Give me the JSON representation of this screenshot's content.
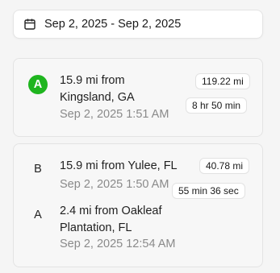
{
  "date_range": {
    "icon": "calendar-icon",
    "label": "Sep 2, 2025 - Sep 2, 2025"
  },
  "trips": [
    {
      "stops": [
        {
          "marker": "A",
          "active": true,
          "title": "15.9 mi from Kingsland, GA",
          "time": "Sep 2, 2025 1:51 AM"
        }
      ],
      "distance": "119.22 mi",
      "duration": "8 hr 50 min"
    },
    {
      "stops": [
        {
          "marker": "B",
          "active": false,
          "title": "15.9 mi from Yulee, FL",
          "time": "Sep 2, 2025 1:50 AM"
        },
        {
          "marker": "A",
          "active": false,
          "title": "2.4 mi from Oakleaf Plantation, FL",
          "time": "Sep 2, 2025 12:54 AM"
        }
      ],
      "distance": "40.78 mi",
      "duration": "55 min 36 sec"
    }
  ],
  "colors": {
    "active_marker": "#1fb51f",
    "muted_text": "#8a8a8a"
  }
}
